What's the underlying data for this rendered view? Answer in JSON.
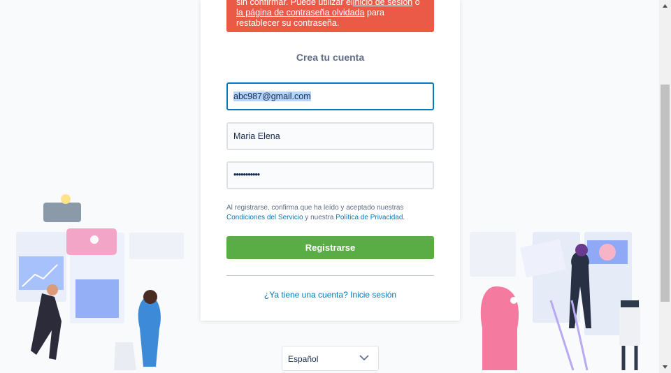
{
  "alert": {
    "line1": "sin confirmar. Puede utilizar el",
    "link1": "inicio de sesión",
    "line1_end": " o",
    "link2": "la página de contraseña olvidada",
    "line2_end": " para",
    "line3": "restablecer su contraseña."
  },
  "form": {
    "title": "Crea tu cuenta",
    "email": "abc987@gmail.com",
    "name": "Maria Elena",
    "password": "•••••••••••",
    "terms_prefix": "Al registrarse, confirma que ha leído y aceptado nuestras",
    "terms_link": "Condiciones del Servicio",
    "terms_mid": " y nuestra ",
    "privacy_link": "Política de Privacidad",
    "terms_end": ".",
    "submit": "Registrarse",
    "login_link": "¿Ya tiene una cuenta? Inicie sesión"
  },
  "language": {
    "selected": "Español"
  },
  "colors": {
    "alert": "#eb5a46",
    "button": "#5aac44",
    "link": "#0079bf",
    "focus": "#0079bf"
  },
  "icons": [
    "chevron-down-icon",
    "scroll-up-arrow-icon",
    "scroll-down-arrow-icon"
  ]
}
